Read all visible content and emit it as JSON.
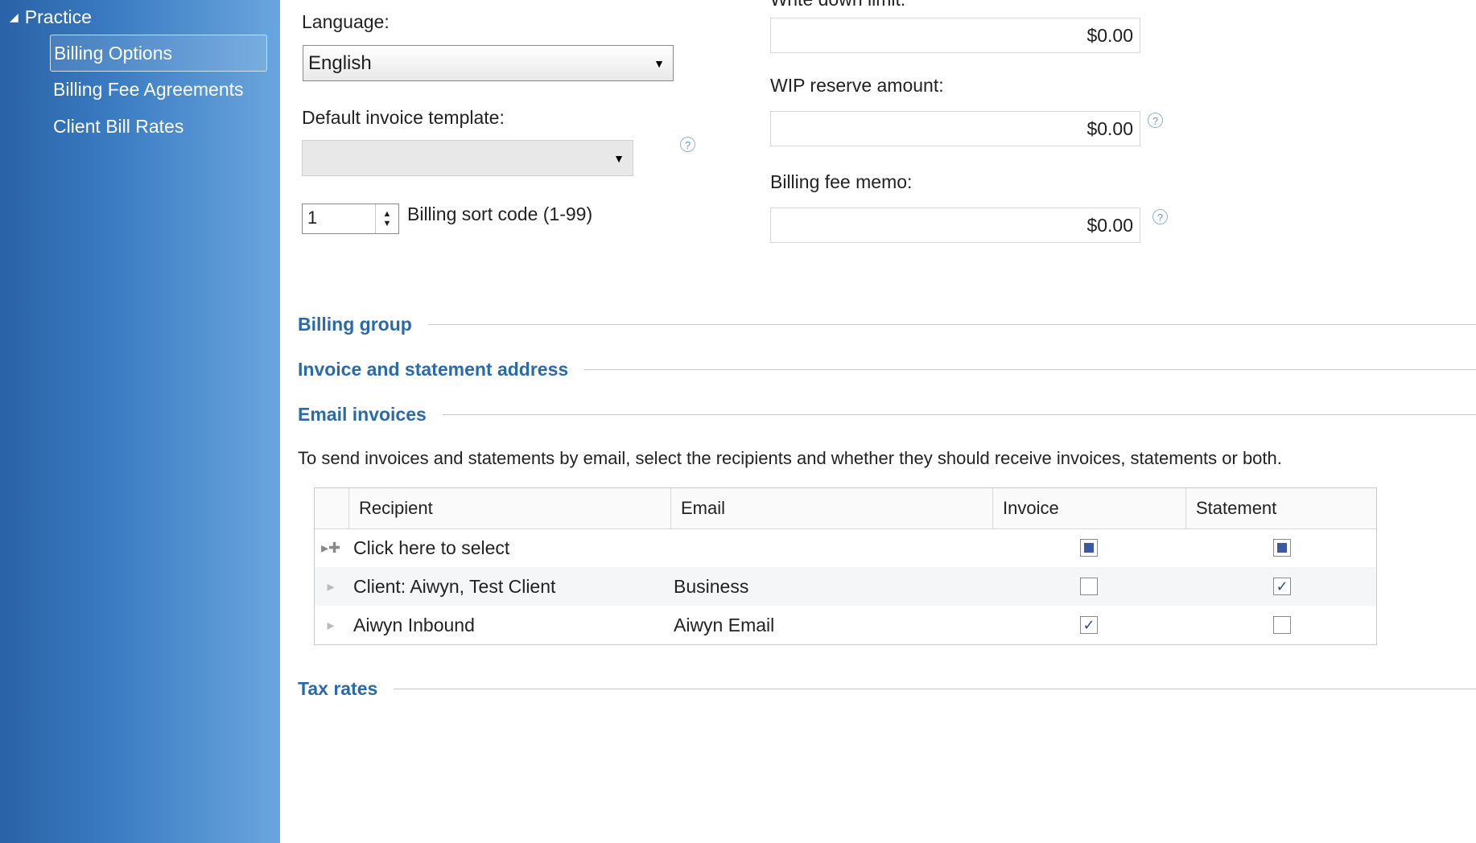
{
  "sidebar": {
    "root": "Practice",
    "items": [
      {
        "label": "Billing Options",
        "selected": true
      },
      {
        "label": "Billing Fee Agreements"
      },
      {
        "label": "Client Bill Rates"
      }
    ]
  },
  "form": {
    "language_label": "Language:",
    "language_value": "English",
    "template_label": "Default invoice template:",
    "template_value": "",
    "sort_value": "1",
    "sort_label": "Billing sort code (1-99)",
    "writedown_label": "Write down limit:",
    "writedown_value": "$0.00",
    "wip_label": "WIP reserve amount:",
    "wip_value": "$0.00",
    "memo_label": "Billing fee memo:",
    "memo_value": "$0.00",
    "help_glyph": "?"
  },
  "sections": {
    "billing_group": "Billing group",
    "address": "Invoice and statement address",
    "email": "Email invoices",
    "tax": "Tax rates"
  },
  "email": {
    "description": "To send invoices and statements by email, select the recipients and whether they should receive invoices, statements or both.",
    "columns": [
      "Recipient",
      "Email",
      "Invoice",
      "Statement"
    ],
    "rows": [
      {
        "recipient": "Click here to select",
        "email": "",
        "invoice": "indeterminate",
        "statement": "indeterminate"
      },
      {
        "recipient": "Client: Aiwyn, Test Client",
        "email": "Business",
        "invoice": "unchecked",
        "statement": "checked"
      },
      {
        "recipient": "Aiwyn Inbound",
        "email": "Aiwyn Email",
        "invoice": "checked",
        "statement": "unchecked"
      }
    ]
  }
}
